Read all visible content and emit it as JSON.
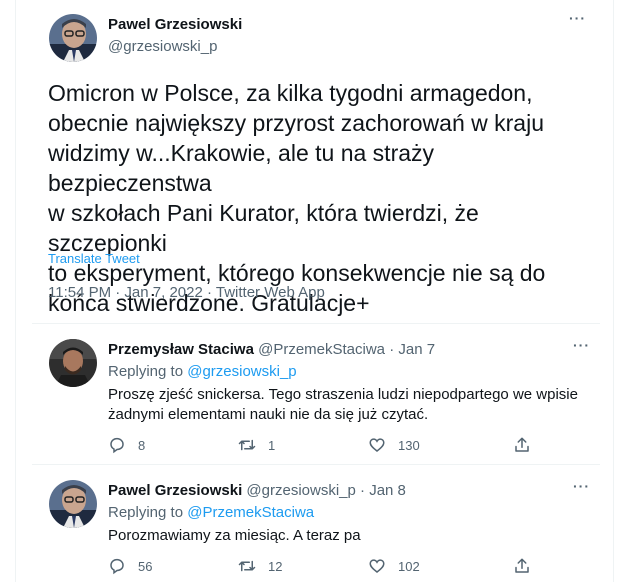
{
  "colors": {
    "accent": "#1d9bf0",
    "muted": "#536471",
    "text": "#0f1419",
    "border": "#eff3f4"
  },
  "main_tweet": {
    "author_name": "Pawel Grzesiowski",
    "author_handle": "@grzesiowski_p",
    "text": "Omicron w Polsce, za kilka tygodni armagedon,\nobecnie największy przyrost zachorowań w kraju\nwidzimy w...Krakowie, ale tu na straży bezpieczenstwa\nw szkołach Pani Kurator, która twierdzi, że szczepionki\nto eksperyment, którego konsekwencje nie są do\nkońca stwierdzone. Gratulacje+",
    "translate_label": "Translate Tweet",
    "meta": "11:54 PM · Jan 7, 2022 · Twitter Web App",
    "more_icon": "more-icon"
  },
  "replies": [
    {
      "author_name": "Przemysław Staciwa",
      "author_handle": "@PrzemekStaciwa",
      "separator": "·",
      "date": "Jan 7",
      "replying_label": "Replying to",
      "replying_to": "@grzesiowski_p",
      "text": "Proszę zjeść snickersa. Tego straszenia ludzi niepodpartego we wpisie\nżadnymi elementami nauki nie da się już czytać.",
      "reply_count": "8",
      "retweet_count": "1",
      "like_count": "130"
    },
    {
      "author_name": "Pawel Grzesiowski",
      "author_handle": "@grzesiowski_p",
      "separator": "·",
      "date": "Jan 8",
      "replying_label": "Replying to",
      "replying_to": "@PrzemekStaciwa",
      "text": "Porozmawiamy za miesiąc. A teraz pa",
      "reply_count": "56",
      "retweet_count": "12",
      "like_count": "102"
    }
  ],
  "icons": [
    "reply-icon",
    "retweet-icon",
    "like-icon",
    "share-icon",
    "more-icon"
  ]
}
